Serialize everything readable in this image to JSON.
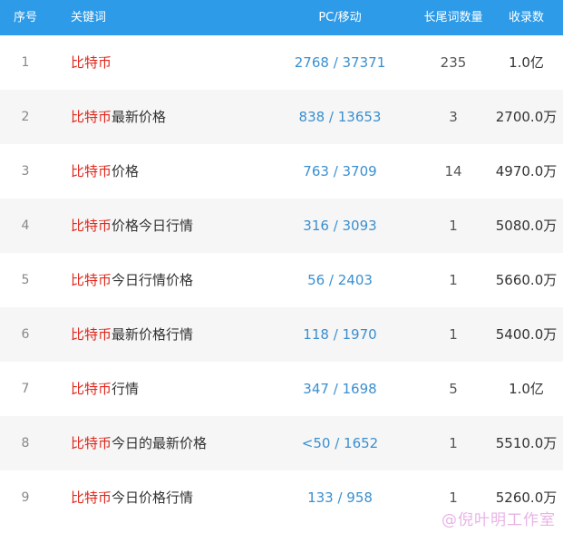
{
  "header": {
    "index": "序号",
    "keyword": "关键词",
    "pc_mobile": "PC/移动",
    "long_tail": "长尾词数量",
    "indexed": "收录数"
  },
  "rows": [
    {
      "index": "1",
      "kw_hl": "比特币",
      "kw_rest": "",
      "pc_mobile": "2768 / 37371",
      "long_tail": "235",
      "indexed": "1.0亿"
    },
    {
      "index": "2",
      "kw_hl": "比特币",
      "kw_rest": "最新价格",
      "pc_mobile": "838 / 13653",
      "long_tail": "3",
      "indexed": "2700.0万"
    },
    {
      "index": "3",
      "kw_hl": "比特币",
      "kw_rest": "价格",
      "pc_mobile": "763 / 3709",
      "long_tail": "14",
      "indexed": "4970.0万"
    },
    {
      "index": "4",
      "kw_hl": "比特币",
      "kw_rest": "价格今日行情",
      "pc_mobile": "316 / 3093",
      "long_tail": "1",
      "indexed": "5080.0万"
    },
    {
      "index": "5",
      "kw_hl": "比特币",
      "kw_rest": "今日行情价格",
      "pc_mobile": "56 / 2403",
      "long_tail": "1",
      "indexed": "5660.0万"
    },
    {
      "index": "6",
      "kw_hl": "比特币",
      "kw_rest": "最新价格行情",
      "pc_mobile": "118 / 1970",
      "long_tail": "1",
      "indexed": "5400.0万"
    },
    {
      "index": "7",
      "kw_hl": "比特币",
      "kw_rest": "行情",
      "pc_mobile": "347 / 1698",
      "long_tail": "5",
      "indexed": "1.0亿"
    },
    {
      "index": "8",
      "kw_hl": "比特币",
      "kw_rest": "今日的最新价格",
      "pc_mobile": "<50 / 1652",
      "long_tail": "1",
      "indexed": "5510.0万"
    },
    {
      "index": "9",
      "kw_hl": "比特币",
      "kw_rest": "今日价格行情",
      "pc_mobile": "133 / 958",
      "long_tail": "1",
      "indexed": "5260.0万"
    }
  ],
  "watermark": "@倪叶明工作室",
  "colors": {
    "header_bg": "#2d9be8",
    "keyword_highlight": "#e0271b",
    "link_blue": "#3a8fd0",
    "row_alt_bg": "#f6f6f6"
  }
}
